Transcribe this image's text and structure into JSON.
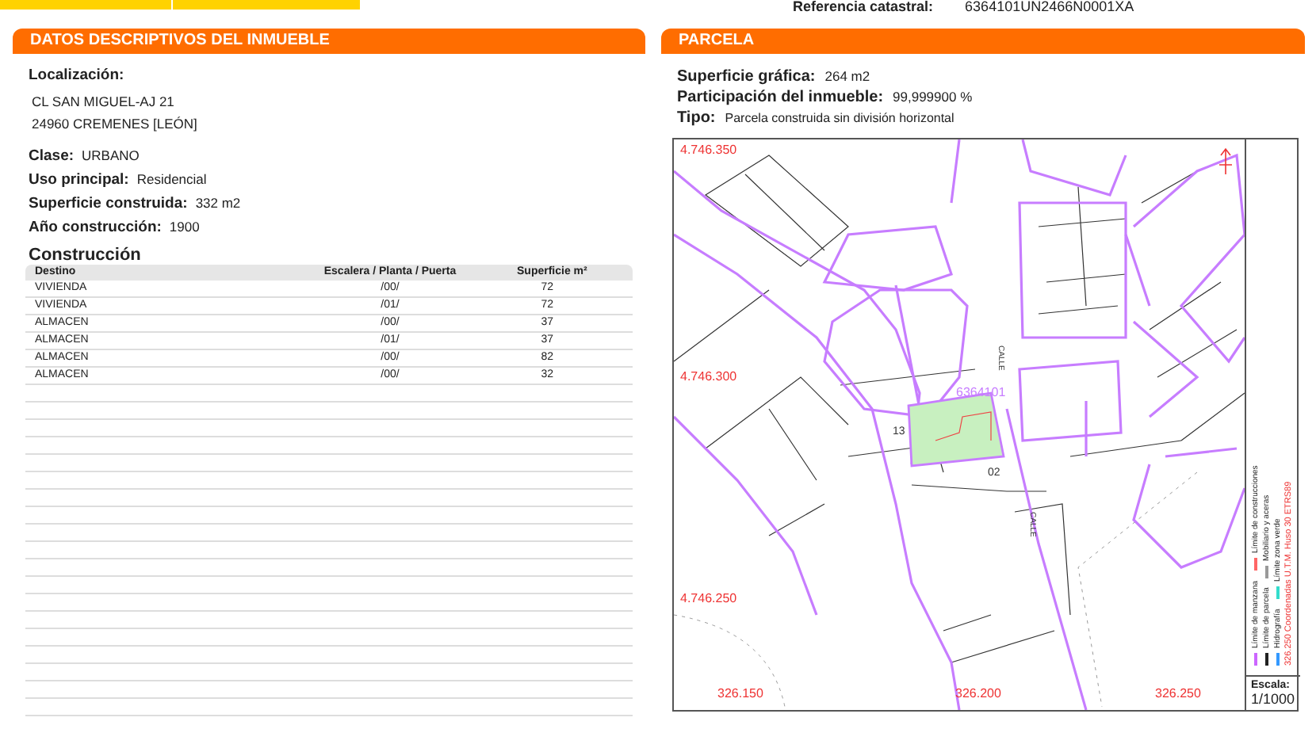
{
  "header": {
    "reference_label": "Referencia catastral:",
    "reference_value": "6364101UN2466N0001XA"
  },
  "left_panel": {
    "title": "DATOS DESCRIPTIVOS DEL **INMUEBLE**",
    "location_label": "Localización:",
    "address_lines": [
      "CL SAN MIGUEL-AJ 21",
      "24960 CREMENES [LEÓN]"
    ],
    "fields": [
      {
        "label": "Clase:",
        "value": "URBANO"
      },
      {
        "label": "Uso principal:",
        "value": "Residencial"
      },
      {
        "label": "Superficie construida:",
        "value": "332 m2"
      },
      {
        "label": "Año construcción:",
        "value": "1900"
      }
    ],
    "construction": {
      "title": "Construcción",
      "columns": [
        "Destino",
        "Escalera / Planta / Puerta",
        "Superficie m²"
      ],
      "rows": [
        [
          "VIVIENDA",
          "/00/",
          "72"
        ],
        [
          "VIVIENDA",
          "/01/",
          "72"
        ],
        [
          "ALMACEN",
          "/00/",
          "37"
        ],
        [
          "ALMACEN",
          "/01/",
          "37"
        ],
        [
          "ALMACEN",
          "/00/",
          "82"
        ],
        [
          "ALMACEN",
          "/00/",
          "32"
        ]
      ]
    }
  },
  "right_panel": {
    "title": "PARCELA",
    "fields": [
      {
        "label": "Superficie gráfica:",
        "value": "264 m2"
      },
      {
        "label": "Participación del inmueble:",
        "value": "99,999900 %"
      },
      {
        "label": "Tipo:",
        "value": "Parcela construida sin división horizontal"
      }
    ],
    "map": {
      "y_coordinates": [
        "4.746.350",
        "4.746.300",
        "4.746.250"
      ],
      "x_coordinates": [
        "326.150",
        "326.200",
        "326.250"
      ],
      "parcel_reference": "6364101",
      "plot_labels": [
        "13",
        "02"
      ],
      "street_labels": [
        "CALLE",
        "CALLE"
      ],
      "legend": [
        {
          "label": "Límite de manzana",
          "color": "#cc66ff"
        },
        {
          "label": "Límite de construcciones",
          "color": "#ff6666"
        },
        {
          "label": "Límite de parcela",
          "color": "#222222"
        },
        {
          "label": "Mobiliario y aceras",
          "color": "#999999"
        },
        {
          "label": "Hidrografía",
          "color": "#3399ff"
        },
        {
          "label": "Límite zona verde",
          "color": "#33ddcc"
        }
      ],
      "coordinates_note": "326.250 Coordenadas U.T.M. Huso 30 ETRS89",
      "scale_label": "Escala:",
      "scale_value": "1/1000"
    }
  }
}
